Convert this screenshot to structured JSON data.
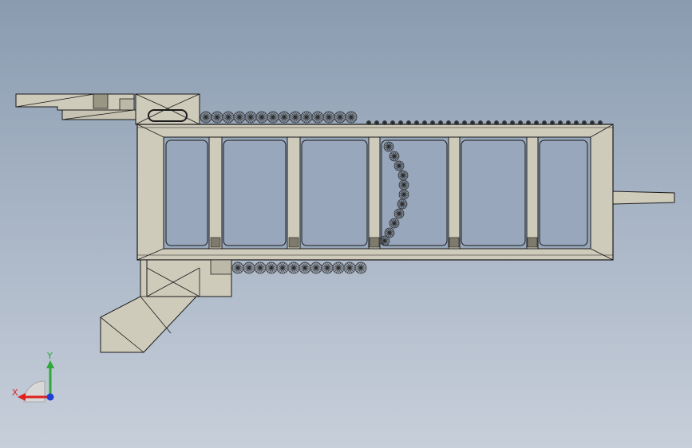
{
  "viewport": {
    "background_top": "#8a9bb0",
    "background_bottom": "#c7cfda"
  },
  "model": {
    "part_fill": "#cfcbbb",
    "part_fill_dark": "#b9b5a4",
    "edge_color": "#1a1a1a",
    "chain_color": "#2a2a2a"
  },
  "triad": {
    "x_label": "X",
    "y_label": "Y",
    "x_color": "#e0201e",
    "y_color": "#2ea838",
    "z_color": "#1f3fd8"
  }
}
